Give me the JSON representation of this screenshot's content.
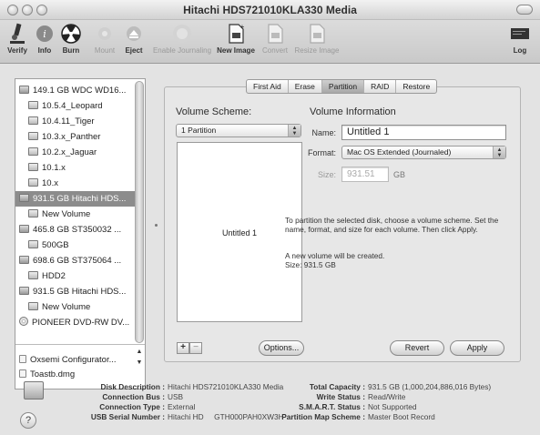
{
  "window": {
    "title": "Hitachi HDS721010KLA330 Media"
  },
  "toolbar": {
    "items": [
      {
        "label": "Verify"
      },
      {
        "label": "Info"
      },
      {
        "label": "Burn"
      },
      {
        "label": "Mount"
      },
      {
        "label": "Eject"
      },
      {
        "label": "Enable Journaling"
      },
      {
        "label": "New Image"
      },
      {
        "label": "Convert"
      },
      {
        "label": "Resize Image"
      },
      {
        "label": "Log"
      }
    ]
  },
  "sidebar": {
    "items": [
      {
        "label": "149.1 GB WDC WD16..."
      },
      {
        "label": "10.5.4_Leopard"
      },
      {
        "label": "10.4.11_Tiger"
      },
      {
        "label": "10.3.x_Panther"
      },
      {
        "label": "10.2.x_Jaguar"
      },
      {
        "label": "10.1.x"
      },
      {
        "label": "10.x"
      },
      {
        "label": "931.5 GB Hitachi HDS..."
      },
      {
        "label": "New Volume"
      },
      {
        "label": "465.8 GB ST350032 ..."
      },
      {
        "label": "500GB"
      },
      {
        "label": "698.6 GB ST375064 ..."
      },
      {
        "label": "HDD2"
      },
      {
        "label": "931.5 GB Hitachi HDS..."
      },
      {
        "label": "New Volume"
      },
      {
        "label": "PIONEER DVD-RW DV..."
      }
    ],
    "images": [
      {
        "label": "Oxsemi Configurator..."
      },
      {
        "label": "Toastb.dmg"
      }
    ]
  },
  "tabs": [
    "First Aid",
    "Erase",
    "Partition",
    "RAID",
    "Restore"
  ],
  "partition": {
    "scheme_heading": "Volume Scheme:",
    "scheme_value": "1 Partition",
    "info_heading": "Volume Information",
    "name_label": "Name:",
    "name_value": "Untitled 1",
    "format_label": "Format:",
    "format_value": "Mac OS Extended (Journaled)",
    "size_label": "Size:",
    "size_value": "931.51",
    "size_unit": "GB",
    "layout_label": "Untitled 1",
    "help_text": "To partition the selected disk, choose a volume scheme. Set the name, format, and size for each volume. Then click Apply.",
    "status_line1": "A new volume will be created.",
    "status_line2": "Size: 931.5 GB",
    "plus": "+",
    "minus": "−",
    "options": "Options...",
    "revert": "Revert",
    "apply": "Apply"
  },
  "footer": {
    "left": [
      {
        "key": "Disk Description :",
        "value": "Hitachi HDS721010KLA330 Media"
      },
      {
        "key": "Connection Bus :",
        "value": "USB"
      },
      {
        "key": "Connection Type :",
        "value": "External"
      },
      {
        "key": "USB Serial Number :",
        "value": "Hitachi HD     GTH000PAH0XW3H"
      }
    ],
    "right": [
      {
        "key": "Total Capacity :",
        "value": "931.5 GB (1,000,204,886,016 Bytes)"
      },
      {
        "key": "Write Status :",
        "value": "Read/Write"
      },
      {
        "key": "S.M.A.R.T. Status :",
        "value": "Not Supported"
      },
      {
        "key": "Partition Map Scheme :",
        "value": "Master Boot Record"
      }
    ],
    "help": "?"
  }
}
